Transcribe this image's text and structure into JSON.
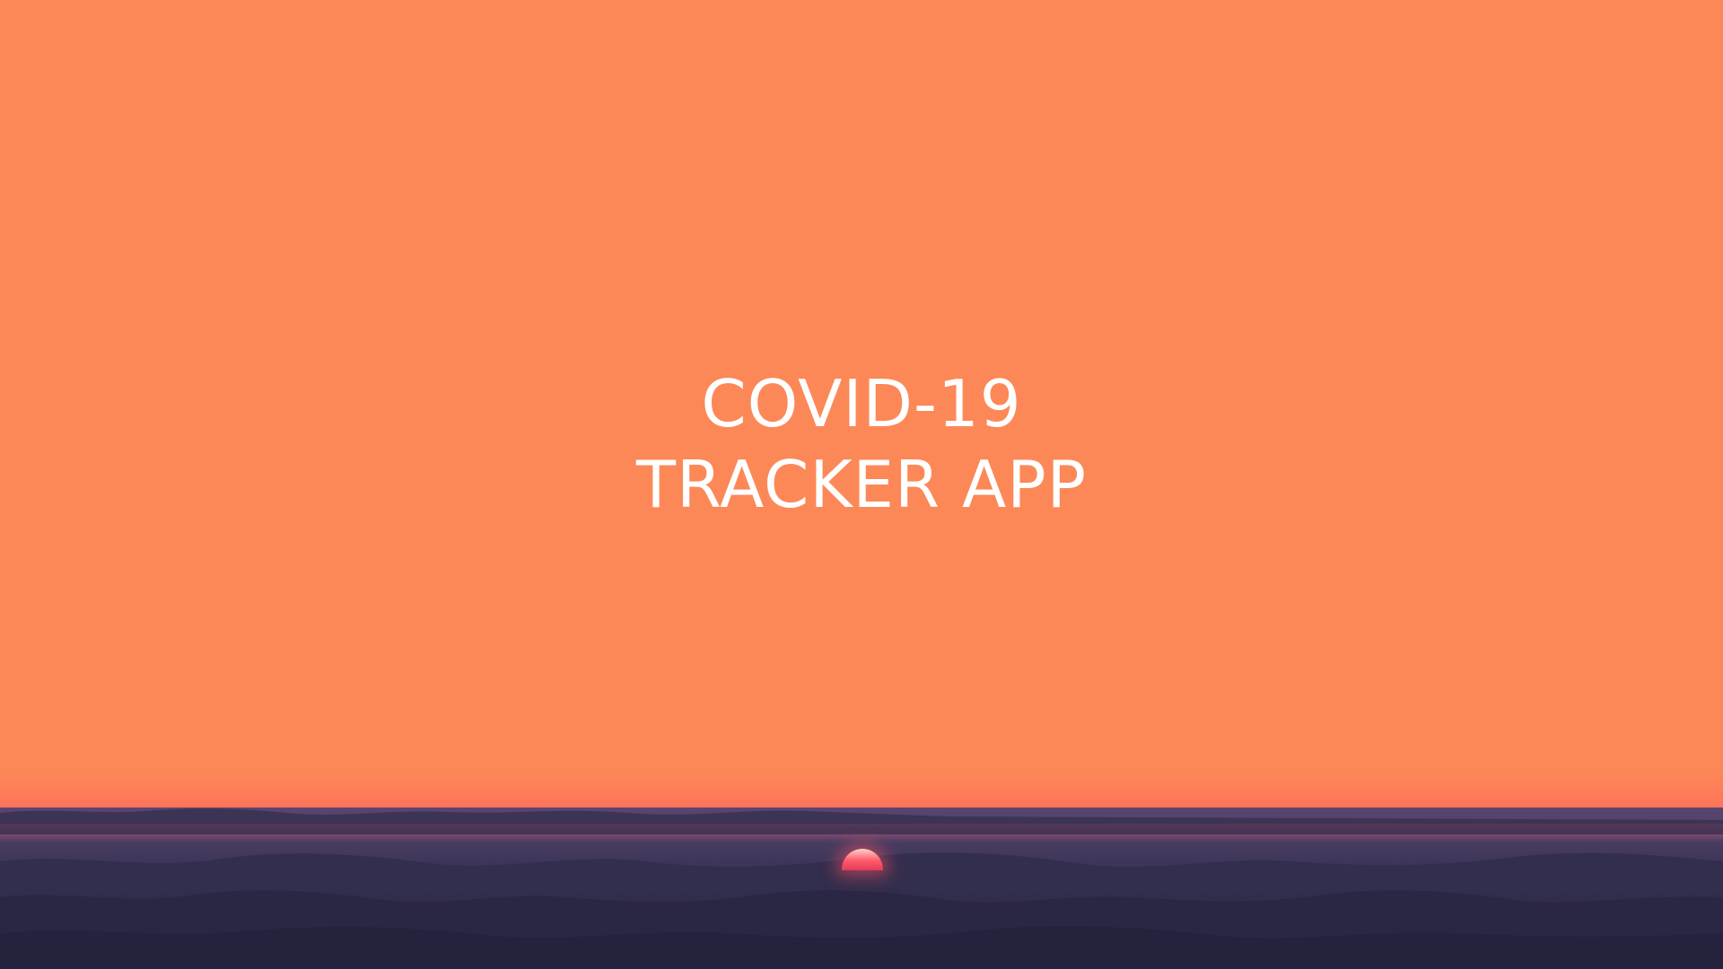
{
  "splash": {
    "title_line1": "COVID-19",
    "title_line2": "TRACKER APP"
  },
  "colors": {
    "sky": "#fc8858",
    "text": "#ffffff",
    "cloud_dark": "#2e2a4a",
    "cloud_mid": "#4a3f66",
    "sunset_glow": "#ff5a6a"
  }
}
